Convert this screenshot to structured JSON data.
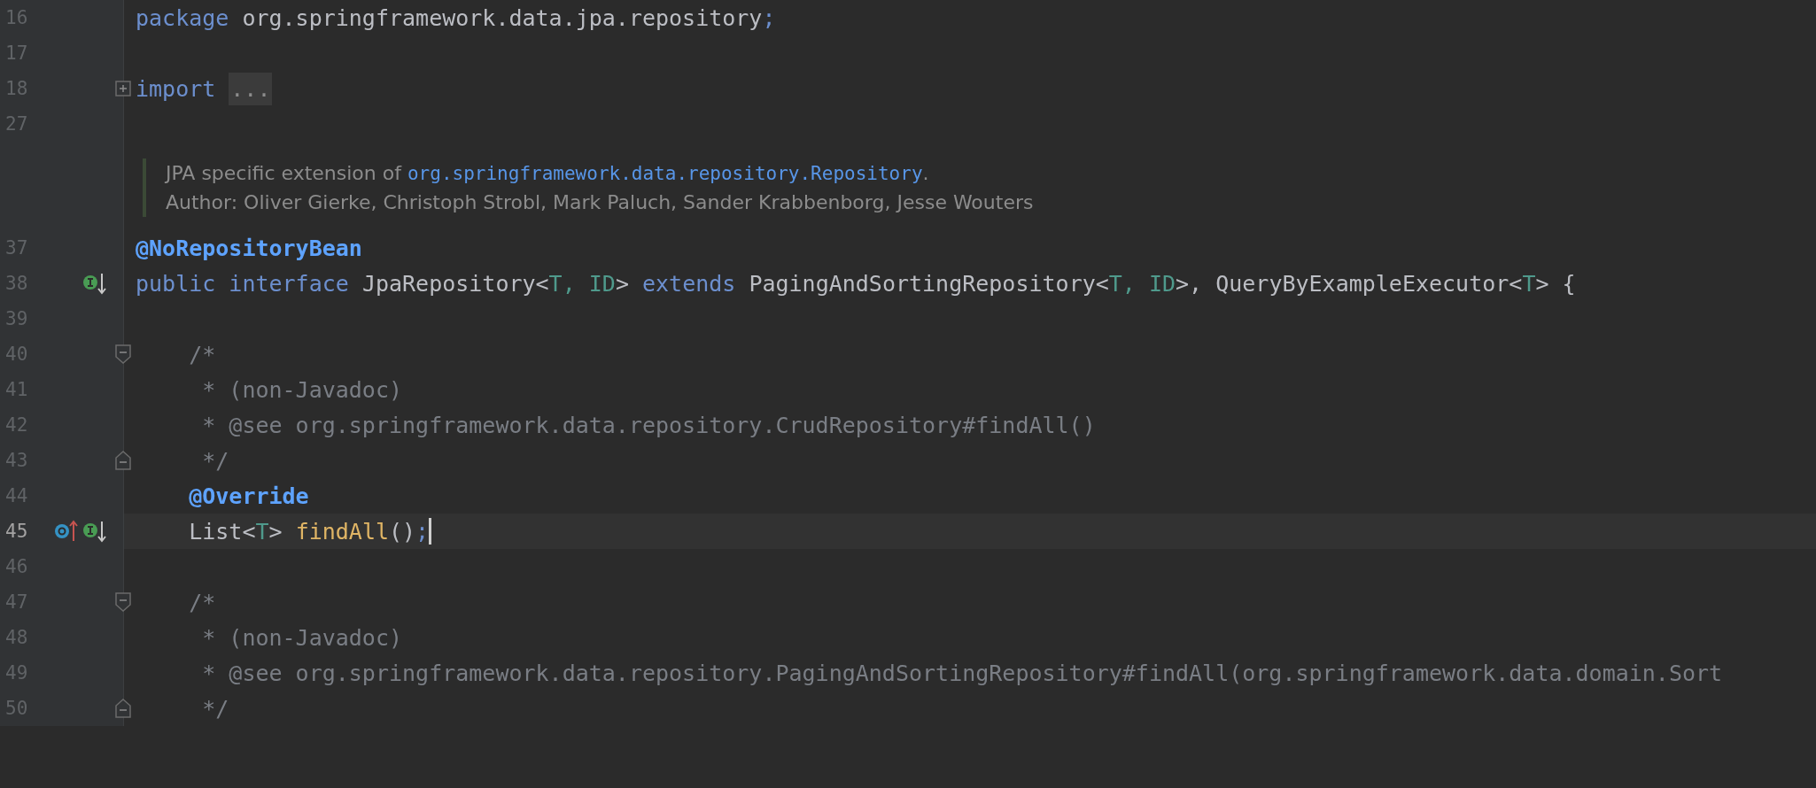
{
  "editor": {
    "lines": [
      {
        "kind": "code",
        "number": "16",
        "current": false,
        "tokens": [
          {
            "kind": "keyword",
            "text": "package"
          },
          {
            "kind": "plain",
            "text": " org.springframework.data.jpa.repository"
          },
          {
            "kind": "punct",
            "text": ";"
          }
        ]
      },
      {
        "kind": "code",
        "number": "17",
        "current": false
      },
      {
        "kind": "code",
        "number": "18",
        "current": false,
        "fold": {
          "kind": "collapsed"
        },
        "tokens": [
          {
            "kind": "keyword",
            "text": "import"
          },
          {
            "kind": "folded",
            "text": "..."
          }
        ]
      },
      {
        "kind": "code",
        "number": "27",
        "current": false
      },
      {
        "kind": "doc",
        "lines": [
          [
            {
              "kind": "text",
              "text": "JPA specific extension of "
            },
            {
              "kind": "link",
              "text": "org.springframework.data.repository.Repository"
            },
            {
              "kind": "text",
              "text": "."
            }
          ],
          [
            {
              "kind": "text",
              "text": "Author: Oliver Gierke, Christoph Strobl, Mark Paluch, Sander Krabbenborg, Jesse Wouters"
            }
          ]
        ]
      },
      {
        "kind": "code",
        "number": "37",
        "current": false,
        "tokens": [
          {
            "kind": "annotation",
            "text": "@NoRepositoryBean"
          }
        ]
      },
      {
        "kind": "code",
        "number": "38",
        "current": false,
        "markers": [
          {
            "kind": "implemented"
          }
        ],
        "tokens": [
          {
            "kind": "keyword",
            "text": "public interface"
          },
          {
            "kind": "plain",
            "text": " JpaRepository<"
          },
          {
            "kind": "typeparam",
            "text": "T, ID"
          },
          {
            "kind": "plain",
            "text": "> "
          },
          {
            "kind": "keyword",
            "text": "extends"
          },
          {
            "kind": "plain",
            "text": " PagingAndSortingRepository<"
          },
          {
            "kind": "typeparam",
            "text": "T, ID"
          },
          {
            "kind": "plain",
            "text": ">, QueryByExampleExecutor<"
          },
          {
            "kind": "typeparam",
            "text": "T"
          },
          {
            "kind": "plain",
            "text": "> {"
          }
        ]
      },
      {
        "kind": "code",
        "number": "39",
        "current": false
      },
      {
        "kind": "code",
        "number": "40",
        "current": false,
        "fold": {
          "kind": "start"
        },
        "tokens": [
          {
            "kind": "comment",
            "text": "    /*"
          }
        ]
      },
      {
        "kind": "code",
        "number": "41",
        "current": false,
        "tokens": [
          {
            "kind": "comment",
            "text": "     * (non-Javadoc)"
          }
        ]
      },
      {
        "kind": "code",
        "number": "42",
        "current": false,
        "tokens": [
          {
            "kind": "comment",
            "text": "     * @see org.springframework.data.repository.CrudRepository#findAll()"
          }
        ]
      },
      {
        "kind": "code",
        "number": "43",
        "current": false,
        "fold": {
          "kind": "end"
        },
        "tokens": [
          {
            "kind": "comment",
            "text": "     */"
          }
        ]
      },
      {
        "kind": "code",
        "number": "44",
        "current": false,
        "tokens": [
          {
            "kind": "annotation",
            "text": "    @Override"
          }
        ]
      },
      {
        "kind": "code",
        "number": "45",
        "current": true,
        "markers": [
          {
            "kind": "overrides"
          },
          {
            "kind": "implemented"
          }
        ],
        "tokens": [
          {
            "kind": "plain",
            "text": "    List<"
          },
          {
            "kind": "typeparam",
            "text": "T"
          },
          {
            "kind": "plain",
            "text": "> "
          },
          {
            "kind": "method",
            "text": "findAll"
          },
          {
            "kind": "plain",
            "text": "()"
          },
          {
            "kind": "punct",
            "text": ";"
          }
        ]
      },
      {
        "kind": "code",
        "number": "46",
        "current": false
      },
      {
        "kind": "code",
        "number": "47",
        "current": false,
        "fold": {
          "kind": "start"
        },
        "tokens": [
          {
            "kind": "comment",
            "text": "    /*"
          }
        ]
      },
      {
        "kind": "code",
        "number": "48",
        "current": false,
        "tokens": [
          {
            "kind": "comment",
            "text": "     * (non-Javadoc)"
          }
        ]
      },
      {
        "kind": "code",
        "number": "49",
        "current": false,
        "tokens": [
          {
            "kind": "comment",
            "text": "     * @see org.springframework.data.repository.PagingAndSortingRepository#findAll(org.springframework.data.domain.Sort"
          }
        ]
      },
      {
        "kind": "code",
        "number": "50",
        "current": false,
        "fold": {
          "kind": "end"
        },
        "tokens": [
          {
            "kind": "comment",
            "text": "     */"
          }
        ]
      }
    ]
  }
}
